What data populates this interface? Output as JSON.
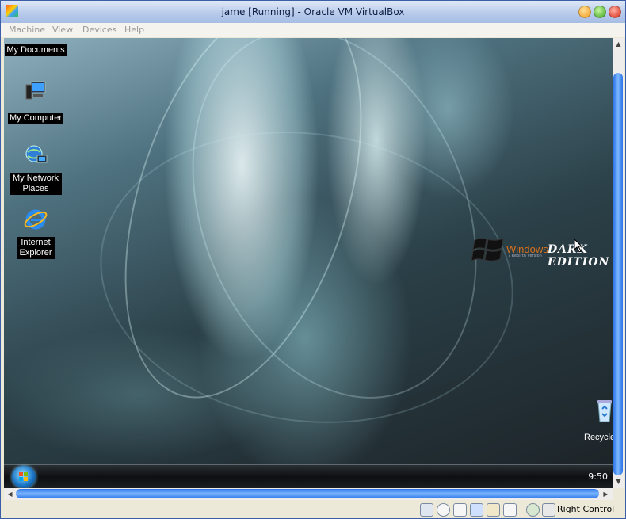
{
  "window": {
    "title": "jame [Running] - Oracle VM VirtualBox"
  },
  "menu": [
    {
      "label": "Machine"
    },
    {
      "label": "View"
    },
    {
      "label": "Devices"
    },
    {
      "label": "Help"
    }
  ],
  "desktop": {
    "icons": [
      {
        "label": "My Documents",
        "icon": "folder-icon"
      },
      {
        "label": "My Computer",
        "icon": "computer-icon"
      },
      {
        "label": "My Network Places",
        "icon": "network-icon"
      },
      {
        "label": "Internet Explorer",
        "icon": "ie-icon"
      },
      {
        "label": "Recycle",
        "icon": "recycle-bin-icon"
      }
    ],
    "branding": {
      "windows": "Windows",
      "sub": "7 Rebirth Version",
      "edition": "DARK EDITION"
    }
  },
  "taskbar": {
    "clock": "9:50"
  },
  "status": {
    "host_key": "Right Control"
  }
}
